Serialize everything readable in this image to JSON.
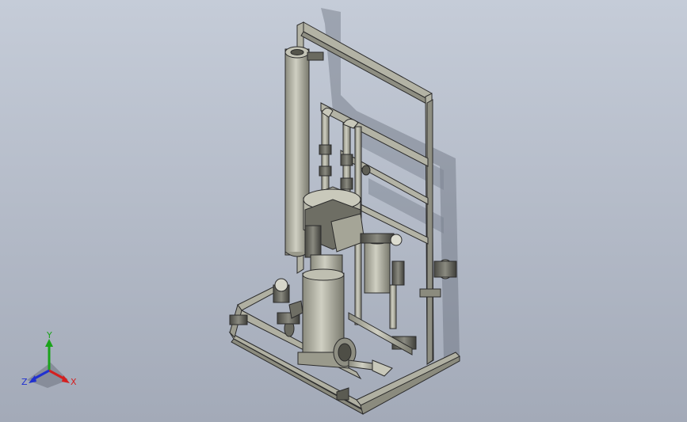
{
  "viewport": {
    "background_top": "#c5ccd8",
    "background_bottom": "#a3aab8",
    "model_color": "#a9a99b",
    "edge_color": "#2b2b2b"
  },
  "triad": {
    "x_label": "X",
    "y_label": "Y",
    "z_label": "Z",
    "x_color": "#d42020",
    "y_color": "#1aa31a",
    "z_color": "#2030d0"
  }
}
